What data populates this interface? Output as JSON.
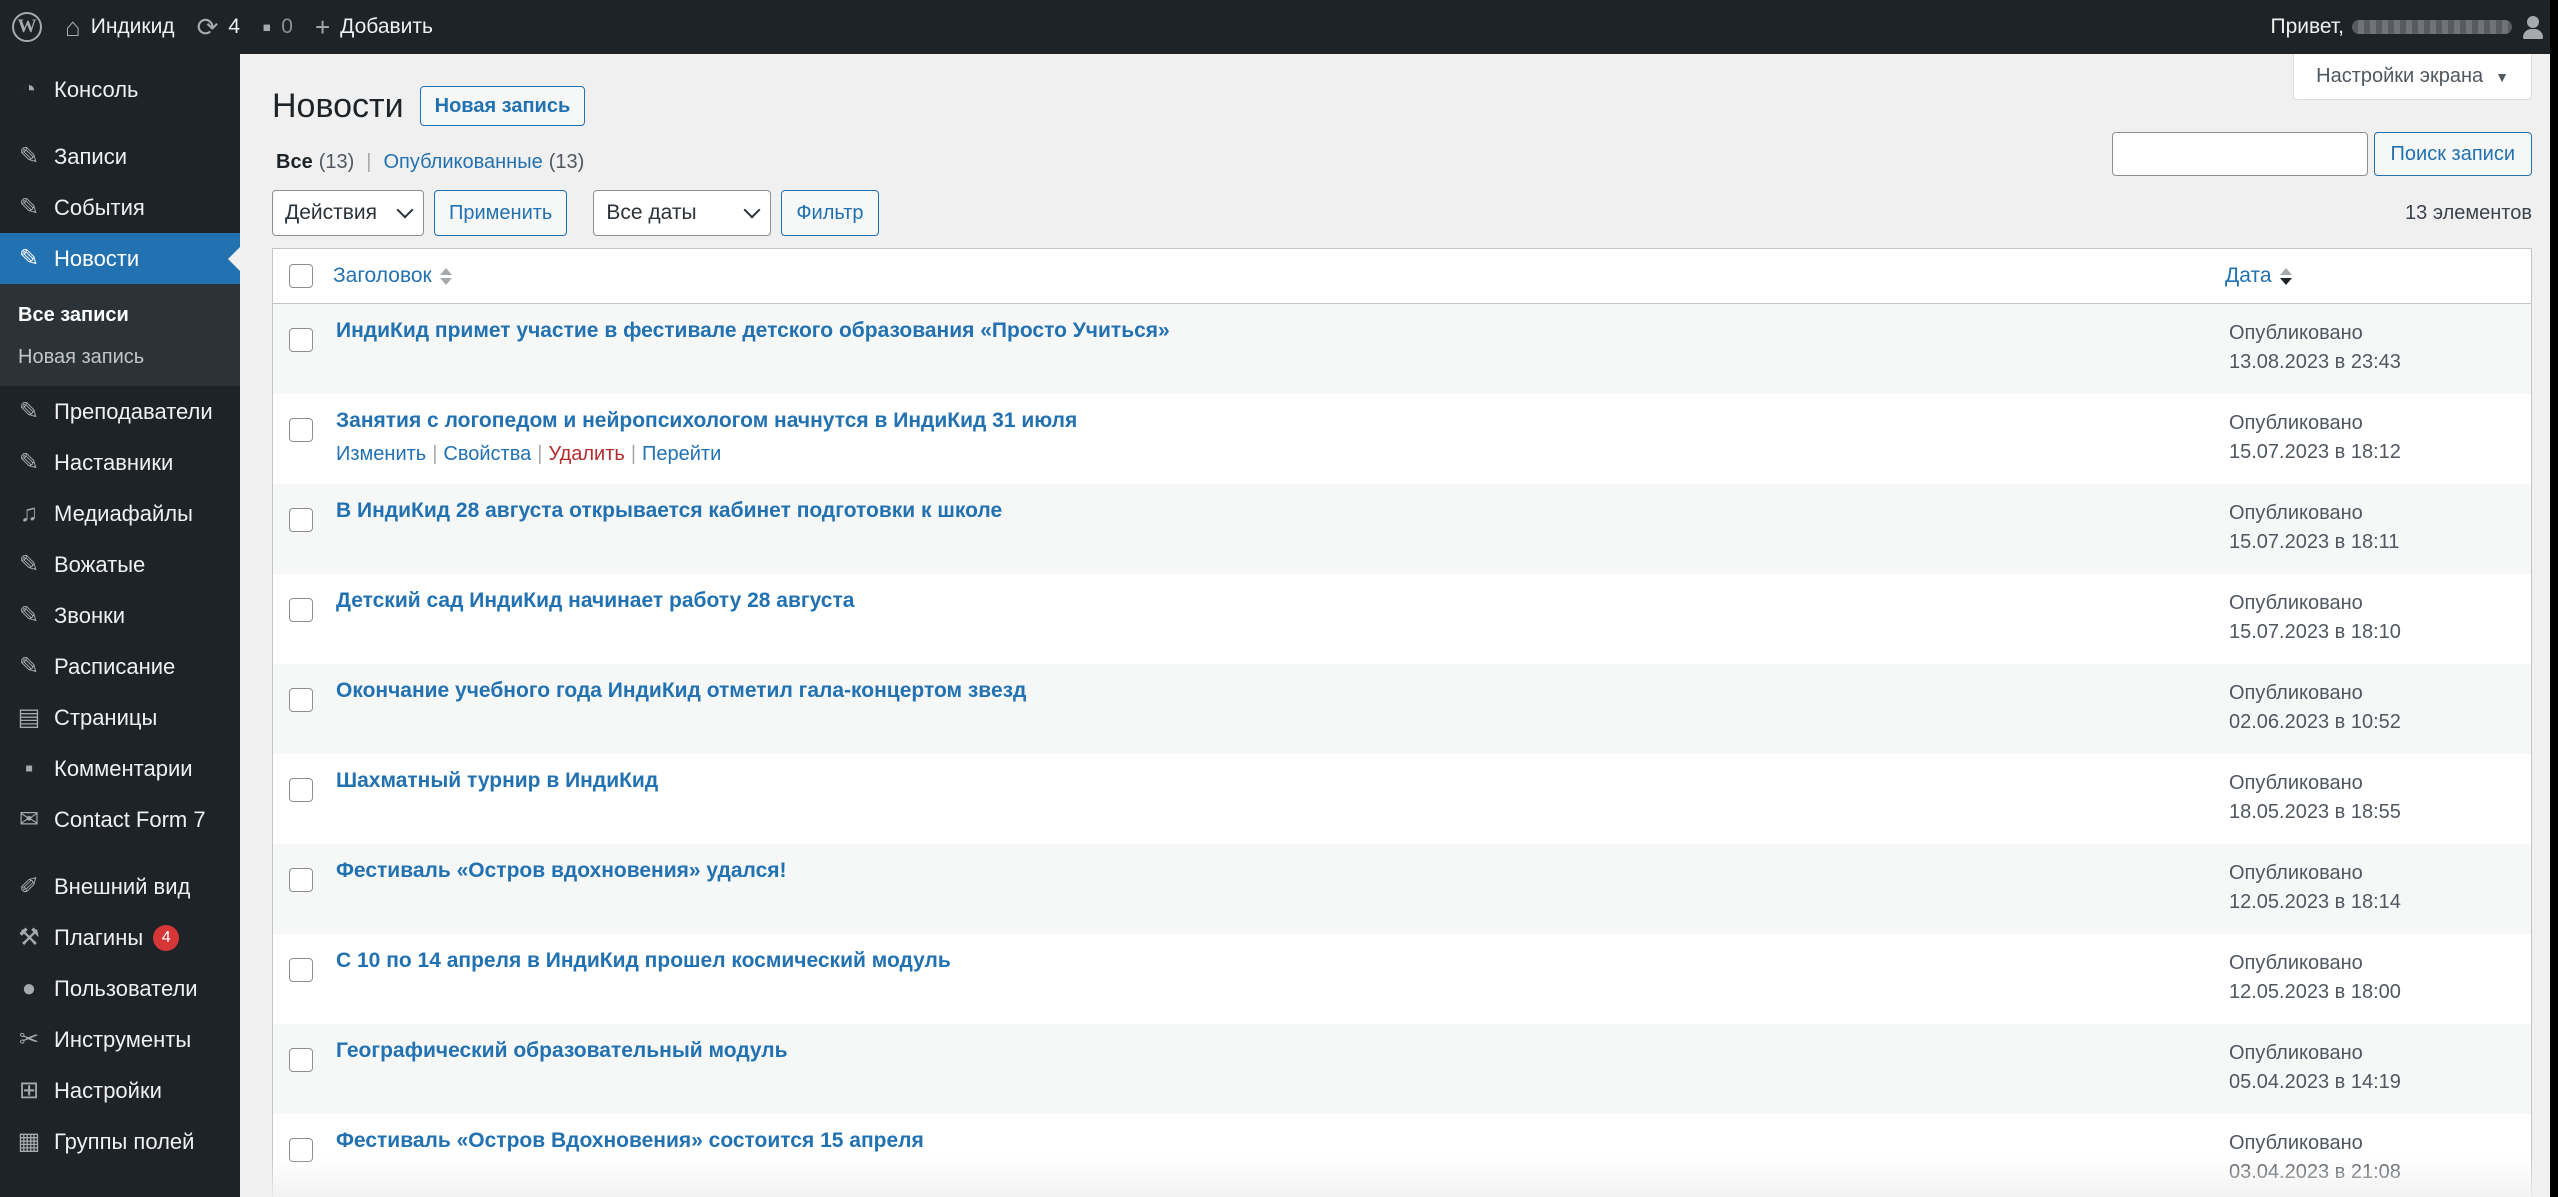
{
  "admin_bar": {
    "site_name": "Индикид",
    "updates_count": "4",
    "comments_count": "0",
    "add_new_label": "Добавить",
    "greeting": "Привет,"
  },
  "sidebar": {
    "items": [
      {
        "label": "Консоль",
        "icon": "dashboard-icon"
      },
      {
        "label": "Записи",
        "icon": "pin-icon"
      },
      {
        "label": "События",
        "icon": "pin-icon"
      },
      {
        "label": "Новости",
        "icon": "pin-icon",
        "active": true
      },
      {
        "label": "Преподаватели",
        "icon": "pin-icon"
      },
      {
        "label": "Наставники",
        "icon": "pin-icon"
      },
      {
        "label": "Медиафайлы",
        "icon": "media-icon"
      },
      {
        "label": "Вожатые",
        "icon": "pin-icon"
      },
      {
        "label": "Звонки",
        "icon": "pin-icon"
      },
      {
        "label": "Расписание",
        "icon": "pin-icon"
      },
      {
        "label": "Страницы",
        "icon": "pages-icon"
      },
      {
        "label": "Комментарии",
        "icon": "comments-icon"
      },
      {
        "label": "Contact Form 7",
        "icon": "mail-icon"
      },
      {
        "label": "Внешний вид",
        "icon": "appearance-icon"
      },
      {
        "label": "Плагины",
        "icon": "plugins-icon",
        "badge": "4"
      },
      {
        "label": "Пользователи",
        "icon": "users-icon"
      },
      {
        "label": "Инструменты",
        "icon": "tools-icon"
      },
      {
        "label": "Настройки",
        "icon": "settings-icon"
      },
      {
        "label": "Группы полей",
        "icon": "table-icon"
      }
    ],
    "submenu": {
      "all_posts": "Все записи",
      "new_post": "Новая запись"
    }
  },
  "header": {
    "screen_options": "Настройки экрана",
    "title": "Новости",
    "add_new": "Новая запись"
  },
  "filters": {
    "all_label": "Все",
    "all_count": "(13)",
    "published_label": "Опубликованные",
    "published_count": "(13)",
    "bulk_actions": "Действия",
    "apply": "Применить",
    "all_dates": "Все даты",
    "filter": "Фильтр",
    "items_count": "13 элементов",
    "search_button": "Поиск записи",
    "search_value": ""
  },
  "table": {
    "col_title": "Заголовок",
    "col_date": "Дата",
    "row_actions": {
      "edit": "Изменить",
      "quick_edit": "Свойства",
      "trash": "Удалить",
      "view": "Перейти"
    },
    "rows": [
      {
        "title": "ИндиКид примет участие в фестивале детского образования «Просто Учиться»",
        "status": "Опубликовано",
        "date": "13.08.2023 в 23:43"
      },
      {
        "title": "Занятия с логопедом и нейропсихологом начнутся в ИндиКид 31 июля",
        "status": "Опубликовано",
        "date": "15.07.2023 в 18:12",
        "hover": true
      },
      {
        "title": "В ИндиКид 28 августа открывается кабинет подготовки к школе",
        "status": "Опубликовано",
        "date": "15.07.2023 в 18:11"
      },
      {
        "title": "Детский сад ИндиКид начинает работу 28 августа",
        "status": "Опубликовано",
        "date": "15.07.2023 в 18:10"
      },
      {
        "title": "Окончание учебного года ИндиКид отметил гала-концертом звезд",
        "status": "Опубликовано",
        "date": "02.06.2023 в 10:52"
      },
      {
        "title": "Шахматный турнир в ИндиКид",
        "status": "Опубликовано",
        "date": "18.05.2023 в 18:55"
      },
      {
        "title": "Фестиваль «Остров вдохновения» удался!",
        "status": "Опубликовано",
        "date": "12.05.2023 в 18:14"
      },
      {
        "title": "С 10 по 14 апреля в ИндиКид прошел космический модуль",
        "status": "Опубликовано",
        "date": "12.05.2023 в 18:00"
      },
      {
        "title": "Географический образовательный модуль",
        "status": "Опубликовано",
        "date": "05.04.2023 в 14:19"
      },
      {
        "title": "Фестиваль «Остров Вдохновения» состоится 15 апреля",
        "status": "Опубликовано",
        "date": "03.04.2023 в 21:08"
      }
    ]
  },
  "colors": {
    "accent": "#2271b1",
    "sidebar_bg": "#1d2327",
    "badge": "#d63638",
    "delete": "#b32d2e"
  }
}
